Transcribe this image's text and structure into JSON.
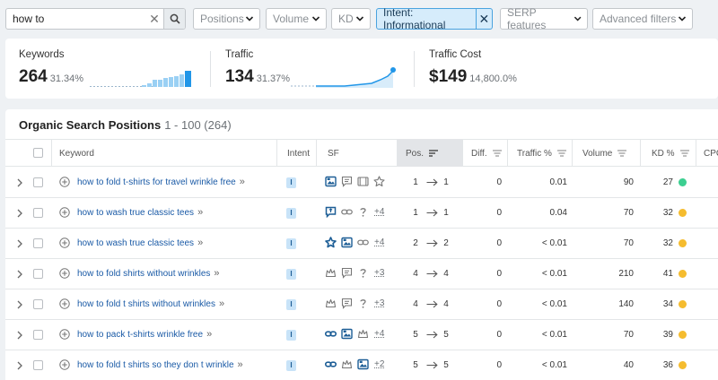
{
  "search": {
    "value": "how to"
  },
  "filters": {
    "positions": "Positions",
    "volume": "Volume",
    "kd": "KD",
    "intent": "Intent: Informational",
    "serp_features": "SERP features",
    "advanced": "Advanced filters"
  },
  "summary": {
    "keywords": {
      "label": "Keywords",
      "value": "264",
      "change": "31.34%"
    },
    "traffic": {
      "label": "Traffic",
      "value": "134",
      "change": "31.37%"
    },
    "traffic_cost": {
      "label": "Traffic Cost",
      "value": "$149",
      "change": "14,800.0%"
    }
  },
  "table": {
    "title": "Organic Search Positions",
    "range": "1 - 100 (264)",
    "headers": {
      "keyword": "Keyword",
      "intent": "Intent",
      "sf": "SF",
      "pos": "Pos.",
      "diff": "Diff.",
      "traffic": "Traffic %",
      "volume": "Volume",
      "kd": "KD %",
      "cpc": "CPC"
    },
    "rows": [
      {
        "keyword": "how to fold t-shirts for travel wrinkle free",
        "intent": "I",
        "sf": [
          "image-pack-icon",
          "reviews-icon",
          "video-icon",
          "star-icon"
        ],
        "sf_more": "",
        "pos_from": "1",
        "pos_to": "1",
        "diff": "0",
        "traffic": "0.01",
        "volume": "90",
        "kd": "27",
        "kd_color": "#3ccf91"
      },
      {
        "keyword": "how to wash true classic tees",
        "intent": "I",
        "sf": [
          "featured-snippet-icon",
          "link-icon",
          "question-icon"
        ],
        "sf_more": "+4",
        "pos_from": "1",
        "pos_to": "1",
        "diff": "0",
        "traffic": "0.04",
        "volume": "70",
        "kd": "32",
        "kd_color": "#f5bc2f"
      },
      {
        "keyword": "how to wash true classic tees",
        "intent": "I",
        "sf": [
          "star-filled-icon",
          "image-pack-icon",
          "link-icon"
        ],
        "sf_more": "+4",
        "pos_from": "2",
        "pos_to": "2",
        "diff": "0",
        "traffic": "< 0.01",
        "volume": "70",
        "kd": "32",
        "kd_color": "#f5bc2f"
      },
      {
        "keyword": "how to fold shirts without wrinkles",
        "intent": "I",
        "sf": [
          "crown-icon",
          "reviews-icon",
          "question-icon"
        ],
        "sf_more": "+3",
        "pos_from": "4",
        "pos_to": "4",
        "diff": "0",
        "traffic": "< 0.01",
        "volume": "210",
        "kd": "41",
        "kd_color": "#f5bc2f"
      },
      {
        "keyword": "how to fold t shirts without wrinkles",
        "intent": "I",
        "sf": [
          "crown-icon",
          "reviews-icon",
          "question-icon"
        ],
        "sf_more": "+3",
        "pos_from": "4",
        "pos_to": "4",
        "diff": "0",
        "traffic": "< 0.01",
        "volume": "140",
        "kd": "34",
        "kd_color": "#f5bc2f"
      },
      {
        "keyword": "how to pack t-shirts wrinkle free",
        "intent": "I",
        "sf": [
          "link-filled-icon",
          "image-pack-icon",
          "crown-icon"
        ],
        "sf_more": "+4",
        "pos_from": "5",
        "pos_to": "5",
        "diff": "0",
        "traffic": "< 0.01",
        "volume": "70",
        "kd": "39",
        "kd_color": "#f5bc2f"
      },
      {
        "keyword": "how to fold t shirts so they don t wrinkle",
        "intent": "I",
        "sf": [
          "link-filled-icon",
          "crown-icon",
          "image-pack-icon"
        ],
        "sf_more": "+2",
        "pos_from": "5",
        "pos_to": "5",
        "diff": "0",
        "traffic": "< 0.01",
        "volume": "40",
        "kd": "36",
        "kd_color": "#f5bc2f"
      }
    ]
  },
  "colors": {
    "accent_blue": "#2196e8",
    "link_blue": "#1a5aa6",
    "kd_green": "#3ccf91",
    "kd_yellow": "#f5bc2f"
  }
}
